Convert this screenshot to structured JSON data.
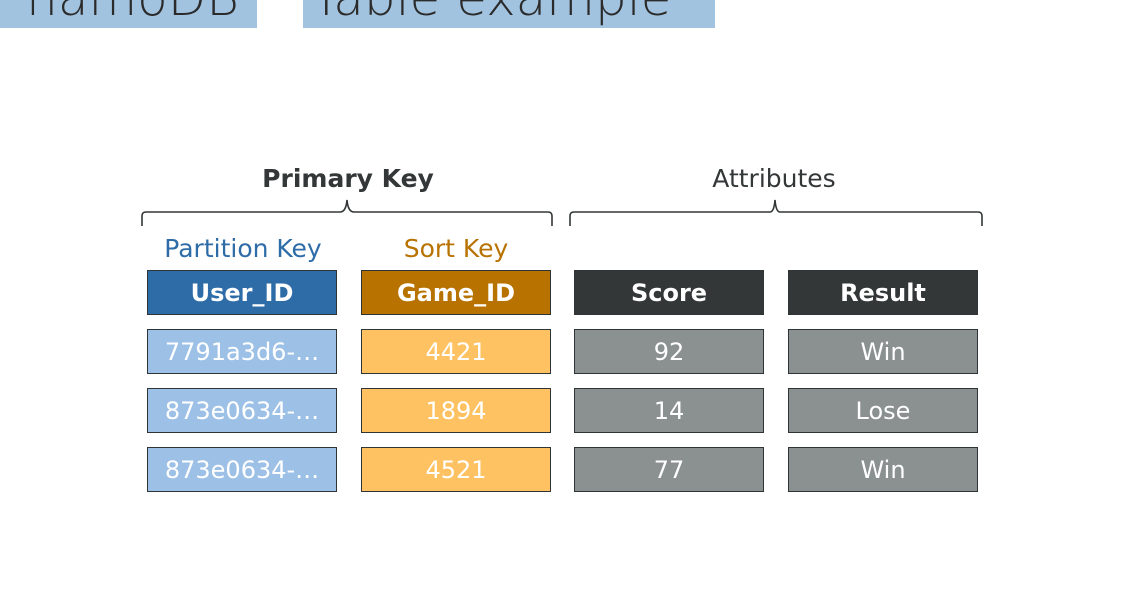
{
  "title": {
    "left_fragment": "namoDB",
    "right_fragment": "Table example"
  },
  "groups": {
    "primary_key": "Primary Key",
    "attributes": "Attributes"
  },
  "key_types": {
    "partition_key": "Partition Key",
    "sort_key": "Sort Key"
  },
  "colors": {
    "partition_header": "#2e6ca8",
    "partition_cell": "#9dc1e6",
    "sort_header": "#b87200",
    "sort_cell": "#ffc262",
    "attribute_header": "#333738",
    "attribute_cell": "#8b9091",
    "title_highlight": "#a2c3df"
  },
  "table": {
    "columns": [
      "User_ID",
      "Game_ID",
      "Score",
      "Result"
    ],
    "rows": [
      [
        "7791a3d6-…",
        "4421",
        "92",
        "Win"
      ],
      [
        "873e0634-…",
        "1894",
        "14",
        "Lose"
      ],
      [
        "873e0634-…",
        "4521",
        "77",
        "Win"
      ]
    ]
  }
}
